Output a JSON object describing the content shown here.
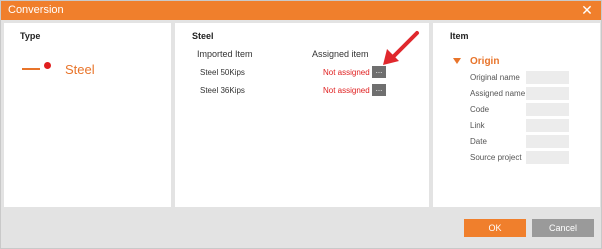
{
  "window": {
    "title": "Conversion",
    "close_glyph": "✕"
  },
  "type_panel": {
    "heading": "Type",
    "option": {
      "label": "Steel",
      "icon": "steel-type-icon"
    }
  },
  "steel_panel": {
    "heading": "Steel",
    "columns": {
      "imported": "Imported Item",
      "assigned": "Assigned item"
    },
    "rows": [
      {
        "imported": "Steel 50Kips",
        "status": "Not assigned",
        "browse_label": "..."
      },
      {
        "imported": "Steel 36Kips",
        "status": "Not assigned",
        "browse_label": "..."
      }
    ]
  },
  "item_panel": {
    "heading": "Item",
    "section": "Origin",
    "properties": [
      {
        "label": "Original name",
        "value": ""
      },
      {
        "label": "Assigned name",
        "value": ""
      },
      {
        "label": "Code",
        "value": ""
      },
      {
        "label": "Link",
        "value": ""
      },
      {
        "label": "Date",
        "value": ""
      },
      {
        "label": "Source project",
        "value": ""
      }
    ]
  },
  "buttons": {
    "ok": "OK",
    "cancel": "Cancel"
  },
  "colors": {
    "accent": "#f07f2c",
    "error": "#e02020",
    "button_gray": "#9a9a9a",
    "browse_button": "#6f6f6f"
  }
}
